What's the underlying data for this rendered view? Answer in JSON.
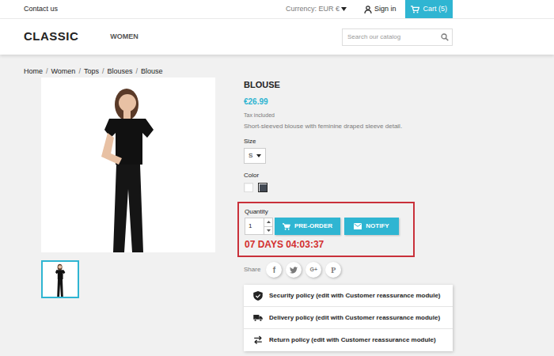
{
  "topbar": {
    "contact": "Contact us",
    "currency": "Currency: EUR €",
    "sign_in": "Sign in",
    "cart": "Cart (5)"
  },
  "header": {
    "logo": "CLASSIC",
    "menu": [
      {
        "label": "WOMEN"
      }
    ],
    "search": {
      "placeholder": "Search our catalog"
    }
  },
  "breadcrumb": {
    "separator": "/",
    "items": [
      "Home",
      "Women",
      "Tops",
      "Blouses",
      "Blouse"
    ]
  },
  "product": {
    "title": "BLOUSE",
    "price": "€26.99",
    "tax": "Tax included",
    "description": "Short-sleeved blouse with feminine draped sleeve detail.",
    "size": {
      "label": "Size",
      "value": "S"
    },
    "color": {
      "label": "Color",
      "swatches": [
        {
          "color": "#ffffff",
          "selected": false
        },
        {
          "color": "#434a54",
          "selected": true
        }
      ]
    },
    "purchase": {
      "quantity_label": "Quantity",
      "quantity": "1",
      "preorder": "PRE-ORDER",
      "notify": "NOTIFY",
      "countdown": "07 DAYS 04:03:37"
    },
    "share": {
      "label": "Share",
      "networks": [
        {
          "kind": "facebook",
          "glyph": "f"
        },
        {
          "kind": "twitter"
        },
        {
          "kind": "googleplus",
          "glyph": "G+"
        },
        {
          "kind": "pinterest",
          "glyph": "P"
        }
      ]
    },
    "reassurance": [
      {
        "kind": "security",
        "label": "Security policy (edit with Customer reassurance module)"
      },
      {
        "kind": "delivery",
        "label": "Delivery policy (edit with Customer reassurance module)"
      },
      {
        "kind": "return",
        "label": "Return policy (edit with Customer reassurance module)"
      }
    ]
  }
}
